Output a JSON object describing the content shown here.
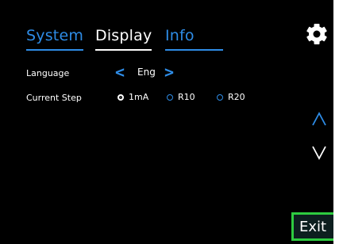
{
  "tabs": [
    {
      "label": "System",
      "active": false
    },
    {
      "label": "Display",
      "active": true
    },
    {
      "label": "Info",
      "active": false
    }
  ],
  "settings": {
    "language": {
      "label": "Language",
      "value": "Eng",
      "prev": "<",
      "next": ">"
    },
    "current_step": {
      "label": "Current Step",
      "options": [
        "1mA",
        "R10",
        "R20"
      ],
      "selected": "1mA"
    }
  },
  "icons": {
    "settings": "gear-icon",
    "scroll_up": "chevron-up-icon",
    "scroll_down": "chevron-down-icon"
  },
  "exit_label": "Exit",
  "colors": {
    "accent": "#2e8ce6",
    "background": "#000000",
    "exit_border": "#2ecc40",
    "text": "#ffffff"
  }
}
